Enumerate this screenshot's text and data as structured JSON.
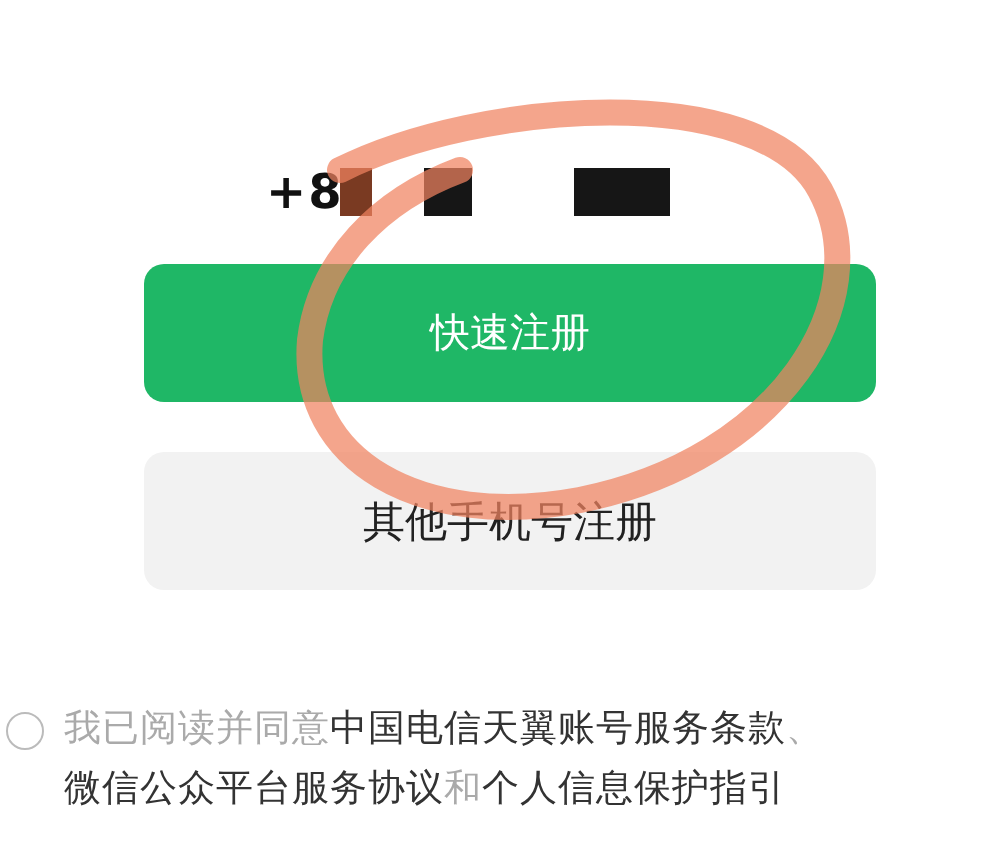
{
  "phone": {
    "text": "+8",
    "redacted": true
  },
  "buttons": [
    {
      "label": "快速注册",
      "kind": "primary"
    },
    {
      "label": "其他手机号注册",
      "kind": "secondary"
    }
  ],
  "agreement": {
    "checked": false,
    "parts": [
      {
        "text": "我已阅读并同意",
        "kind": "plain"
      },
      {
        "text": "中国电信天翼账号服务条款",
        "kind": "link"
      },
      {
        "text": "、",
        "kind": "plain"
      },
      {
        "text": "微信公众平台服务协议",
        "kind": "link"
      },
      {
        "text": "和",
        "kind": "plain"
      },
      {
        "text": "个人信息保护指引",
        "kind": "link"
      }
    ]
  },
  "annotation": {
    "kind": "hand-drawn-circle"
  }
}
